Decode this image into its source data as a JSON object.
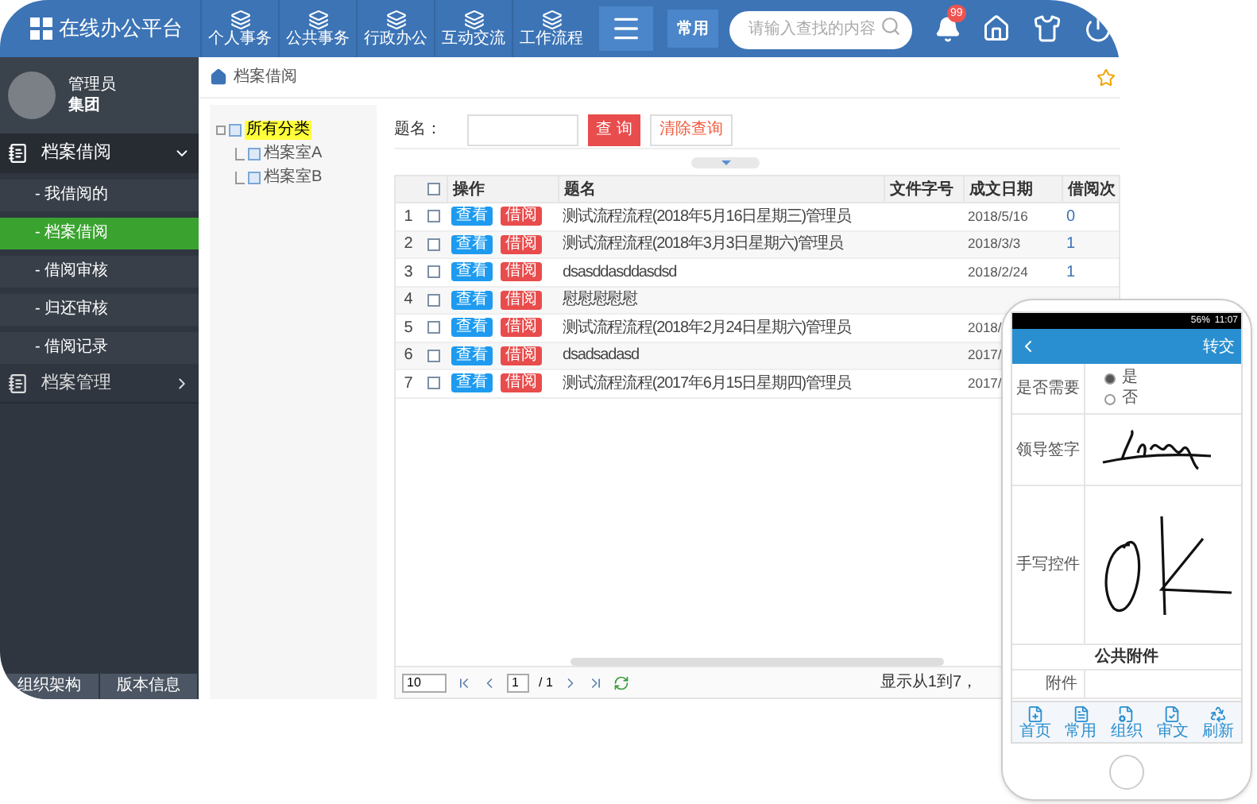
{
  "topbar": {
    "logo": "在线办公平台",
    "nav": [
      "个人事务",
      "公共事务",
      "行政办公",
      "互动交流",
      "工作流程"
    ],
    "common": "常用",
    "search": {
      "placeholder": "请输入查找的内容"
    },
    "badge": "99"
  },
  "user": {
    "role": "管理员",
    "group": "集团"
  },
  "sidebar": {
    "groups": [
      {
        "label": "档案借阅",
        "expanded": true,
        "children": [
          {
            "label": "- 我借阅的",
            "selected": false
          },
          {
            "label": "- 档案借阅",
            "selected": true
          },
          {
            "label": "- 借阅审核",
            "selected": false
          },
          {
            "label": "- 归还审核",
            "selected": false
          },
          {
            "label": "- 借阅记录",
            "selected": false
          }
        ]
      },
      {
        "label": "档案管理",
        "expanded": false
      }
    ],
    "footer_tabs": [
      "组织架构",
      "版本信息"
    ]
  },
  "breadcrumb": "档案借阅",
  "tree": {
    "label": "所有分类",
    "selected": true,
    "children": [
      {
        "label": "档案室A",
        "selected": false
      },
      {
        "label": "档案室B",
        "selected": false
      }
    ]
  },
  "search": {
    "label": "题名：",
    "query_button": "查 询",
    "clear_button": "清除查询"
  },
  "table": {
    "select_all_checked": false,
    "columns": [
      "操作",
      "题名",
      "文件字号",
      "成文日期",
      "借阅次"
    ],
    "rows": [
      {
        "index": "1",
        "checked": false,
        "view": "查看",
        "borrow": "借阅",
        "title": "测试流程流程(2018年5月16日星期三)管理员",
        "date": "2018/5/16",
        "count": "0"
      },
      {
        "index": "2",
        "checked": false,
        "view": "查看",
        "borrow": "借阅",
        "title": "测试流程流程(2018年3月3日星期六)管理员",
        "date": "2018/3/3",
        "count": "1"
      },
      {
        "index": "3",
        "checked": false,
        "view": "查看",
        "borrow": "借阅",
        "title": "dsasddasddasdsd",
        "date": "2018/2/24",
        "count": "1"
      },
      {
        "index": "4",
        "checked": false,
        "view": "查看",
        "borrow": "借阅",
        "title": "慰慰慰慰慰"
      },
      {
        "index": "5",
        "checked": false,
        "view": "查看",
        "borrow": "借阅",
        "title": "测试流程流程(2018年2月24日星期六)管理员",
        "date": "2018/"
      },
      {
        "index": "6",
        "checked": false,
        "view": "查看",
        "borrow": "借阅",
        "title": "dsadsadasd",
        "date": "2017/"
      },
      {
        "index": "7",
        "checked": false,
        "view": "查看",
        "borrow": "借阅",
        "title": "测试流程流程(2017年6月15日星期四)管理员",
        "date": "2017/"
      }
    ]
  },
  "pagination": {
    "page_size": "10",
    "page": "1",
    "total_pages": "/ 1",
    "summary": "显示从1到7，"
  },
  "phone": {
    "battery": "56%",
    "time": "11:07",
    "title": "转交",
    "fields": [
      {
        "kind": "radio",
        "label": "是否需要",
        "options": [
          {
            "label": "是",
            "selected": true
          },
          {
            "label": "否",
            "selected": false
          }
        ]
      },
      {
        "kind": "signature",
        "label": "领导签字"
      },
      {
        "kind": "handwriting",
        "label": "手写控件"
      },
      {
        "kind": "section",
        "label": "公共附件"
      },
      {
        "kind": "attachment",
        "label": "附件"
      }
    ],
    "nav": [
      "首页",
      "常用",
      "组织",
      "审文",
      "刷新"
    ]
  }
}
